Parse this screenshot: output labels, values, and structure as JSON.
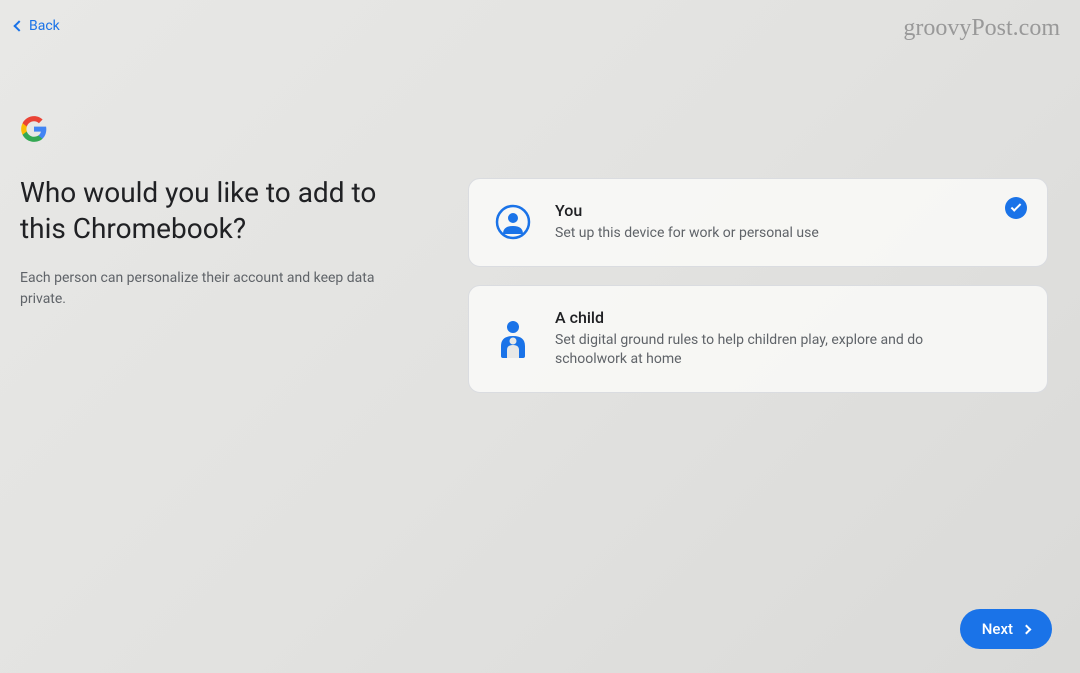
{
  "nav": {
    "back_label": "Back"
  },
  "watermark": "groovyPost.com",
  "logo_letter": "G",
  "heading": "Who would you like to add to this Chromebook?",
  "subtext": "Each person can personalize their account and keep data private.",
  "options": [
    {
      "title": "You",
      "description": "Set up this device for work or personal use",
      "selected": true
    },
    {
      "title": "A child",
      "description": "Set digital ground rules to help children play, explore and do schoolwork at home",
      "selected": false
    }
  ],
  "next_label": "Next"
}
